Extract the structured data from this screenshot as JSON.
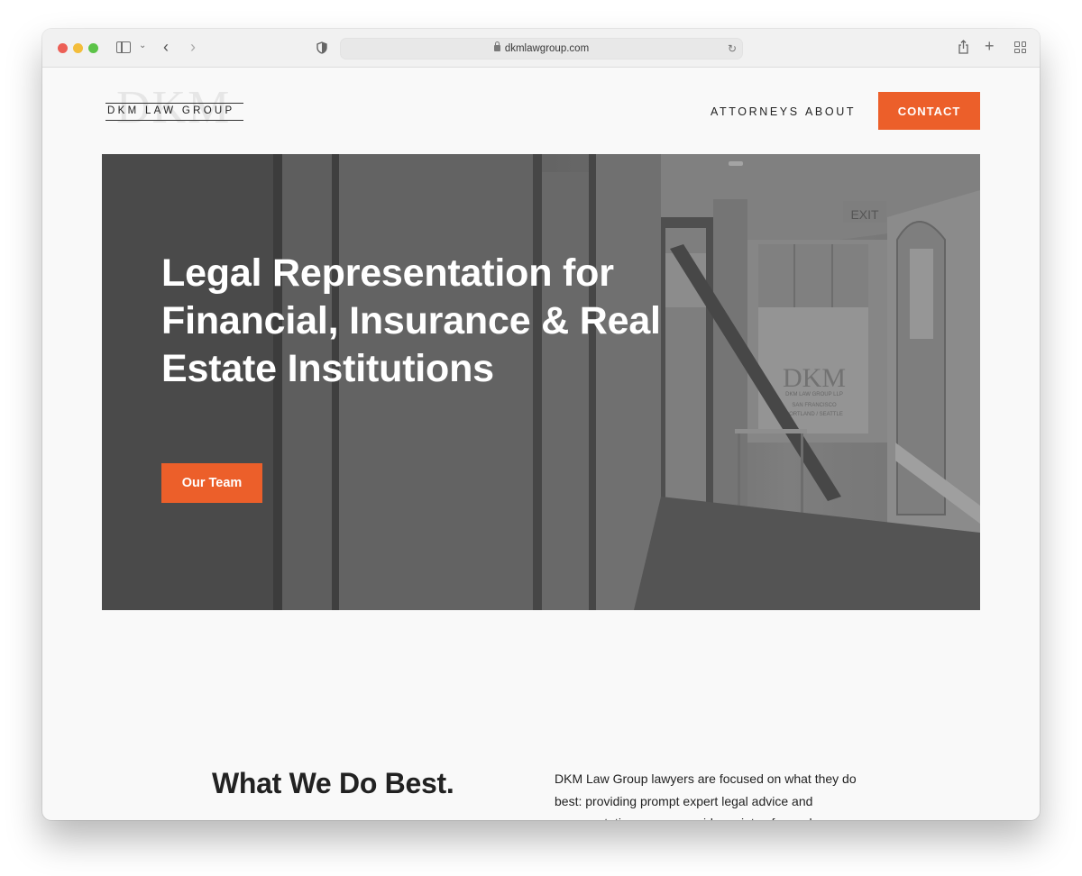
{
  "browser": {
    "url": "dkmlawgroup.com",
    "icons": [
      "sidebar-icon",
      "chevron-down-icon",
      "back-icon",
      "forward-icon",
      "shield-icon",
      "lock-icon",
      "reload-icon",
      "share-icon",
      "new-tab-icon",
      "tab-overview-icon"
    ]
  },
  "header": {
    "logo_monogram": "DKM",
    "logo_text": "DKM LAW GROUP",
    "nav": [
      {
        "label": "ATTORNEYS"
      },
      {
        "label": "ABOUT"
      }
    ],
    "contact_label": "CONTACT"
  },
  "hero": {
    "title": "Legal Representation for Financial, Insurance & Real Estate Institutions",
    "button_label": "Our Team",
    "scene_text": {
      "exit_sign": "EXIT",
      "window_monogram": "DKM",
      "window_line1": "DKM LAW GROUP LLP",
      "window_line2": "SAN FRANCISCO",
      "window_line3": "PORTLAND / SEATTLE"
    }
  },
  "intro": {
    "title": "What We Do Best.",
    "text": "DKM Law Group lawyers are focused on what they do best: providing prompt expert legal advice and representation on a very wide variety of complex"
  },
  "colors": {
    "accent": "#ec5f2a",
    "page_bg": "#f9f9f9",
    "text": "#222222"
  }
}
